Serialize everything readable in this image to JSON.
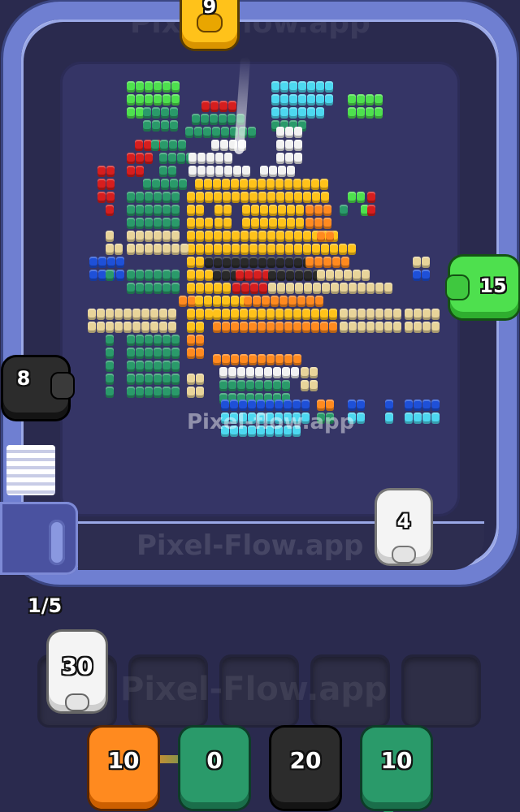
{
  "app": {
    "watermark": "Pixel-flow.app",
    "board_watermark": "Pixel-Flow.app"
  },
  "hud": {
    "progress": "1/5"
  },
  "conveyor_shooters": [
    {
      "id": "top",
      "color": "yellow",
      "ammo": "9"
    },
    {
      "id": "right",
      "color": "green",
      "ammo": "15"
    },
    {
      "id": "left",
      "color": "black",
      "ammo": "8"
    },
    {
      "id": "bottom",
      "color": "white",
      "ammo": "4"
    }
  ],
  "queue_slots": [
    {
      "filled": true,
      "color": "white",
      "ammo": "30"
    },
    {
      "filled": false
    },
    {
      "filled": false
    },
    {
      "filled": false
    },
    {
      "filled": false
    }
  ],
  "bottom_shooters": [
    {
      "color": "orange",
      "ammo": "10"
    },
    {
      "color": "teal",
      "ammo": "0"
    },
    {
      "color": "black",
      "ammo": "20"
    },
    {
      "color": "teal",
      "ammo": "10"
    }
  ],
  "colors": {
    "background": "#2a2a4e",
    "board": "#37376a",
    "track": "#6b7cc8",
    "yellow": "#ffc21a",
    "orange": "#ff8a1f",
    "teal": "#2a9a6a",
    "green": "#4ee04e",
    "black": "#2a2a2a",
    "white": "#f2f2f2"
  }
}
